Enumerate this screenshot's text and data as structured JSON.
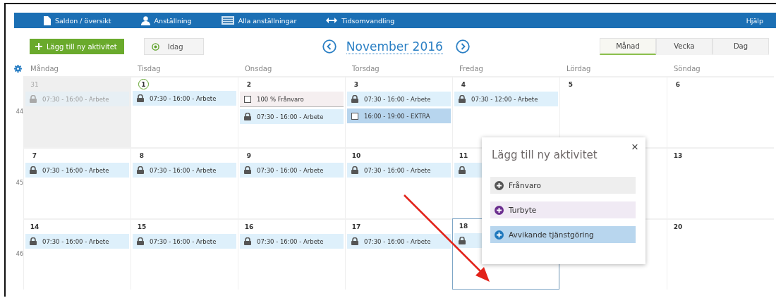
{
  "nav": {
    "items": [
      {
        "label": "Saldon / översikt"
      },
      {
        "label": "Anställning"
      },
      {
        "label": "Alla anställningar"
      },
      {
        "label": "Tidsomvandling"
      }
    ],
    "help": "Hjälp"
  },
  "toolbar": {
    "add_button": "Lägg till ny aktivitet",
    "today_button": "Idag",
    "month_title": "November 2016",
    "views": [
      {
        "label": "Månad",
        "selected": true
      },
      {
        "label": "Vecka",
        "selected": false
      },
      {
        "label": "Dag",
        "selected": false
      }
    ]
  },
  "calendar": {
    "weekdays": [
      "Måndag",
      "Tisdag",
      "Onsdag",
      "Torsdag",
      "Fredag",
      "Lördag",
      "Söndag"
    ],
    "weeks": [
      {
        "number": "44",
        "days": [
          {
            "date": "31",
            "other_month": true,
            "today": false,
            "selected": false,
            "events": [
              {
                "kind": "work",
                "text": "07:30 - 16:00 - Arbete"
              }
            ]
          },
          {
            "date": "1",
            "other_month": false,
            "today": true,
            "selected": false,
            "events": [
              {
                "kind": "work",
                "text": "07:30 - 16:00 - Arbete"
              }
            ]
          },
          {
            "date": "2",
            "other_month": false,
            "today": false,
            "selected": false,
            "events": [
              {
                "kind": "absence",
                "text": "100 % Frånvaro"
              },
              {
                "kind": "work",
                "text": "07:30 - 16:00 - Arbete"
              }
            ]
          },
          {
            "date": "3",
            "other_month": false,
            "today": false,
            "selected": false,
            "events": [
              {
                "kind": "work",
                "text": "07:30 - 16:00 - Arbete"
              },
              {
                "kind": "extra",
                "text": "16:00 - 19:00 - EXTRA"
              }
            ]
          },
          {
            "date": "4",
            "other_month": false,
            "today": false,
            "selected": false,
            "events": [
              {
                "kind": "work",
                "text": "07:30 - 12:00 - Arbete"
              }
            ]
          },
          {
            "date": "5",
            "other_month": false,
            "today": false,
            "selected": false
          },
          {
            "date": "6",
            "other_month": false,
            "today": false,
            "selected": false
          }
        ]
      },
      {
        "number": "45",
        "days": [
          {
            "date": "7",
            "other_month": false,
            "today": false,
            "selected": false,
            "events": [
              {
                "kind": "work",
                "text": "07:30 - 16:00 - Arbete"
              }
            ]
          },
          {
            "date": "8",
            "other_month": false,
            "today": false,
            "selected": false,
            "events": [
              {
                "kind": "work",
                "text": "07:30 - 16:00 - Arbete"
              }
            ]
          },
          {
            "date": "9",
            "other_month": false,
            "today": false,
            "selected": false,
            "events": [
              {
                "kind": "work",
                "text": "07:30 - 16:00 - Arbete"
              }
            ]
          },
          {
            "date": "10",
            "other_month": false,
            "today": false,
            "selected": false,
            "events": [
              {
                "kind": "work",
                "text": "07:30 - 16:00 - Arbete"
              }
            ]
          },
          {
            "date": "11",
            "other_month": false,
            "today": false,
            "selected": false,
            "events": [
              {
                "kind": "work"
              }
            ]
          },
          {
            "other_month": false,
            "today": false,
            "selected": false
          },
          {
            "date": "13",
            "other_month": false,
            "today": false,
            "selected": false
          }
        ]
      },
      {
        "number": "46",
        "days": [
          {
            "date": "14",
            "other_month": false,
            "today": false,
            "selected": false,
            "events": [
              {
                "kind": "work",
                "text": "07:30 - 16:00 - Arbete"
              }
            ]
          },
          {
            "date": "15",
            "other_month": false,
            "today": false,
            "selected": false,
            "events": [
              {
                "kind": "work",
                "text": "07:30 - 16:00 - Arbete"
              }
            ]
          },
          {
            "date": "16",
            "other_month": false,
            "today": false,
            "selected": false,
            "events": [
              {
                "kind": "work",
                "text": "07:30 - 16:00 - Arbete"
              }
            ]
          },
          {
            "date": "17",
            "other_month": false,
            "today": false,
            "selected": false,
            "events": [
              {
                "kind": "work",
                "text": "07:30 - 16:00 - Arbete"
              }
            ]
          },
          {
            "date": "18",
            "other_month": false,
            "today": false,
            "selected": true,
            "events": [
              {
                "kind": "work"
              }
            ]
          },
          {
            "other_month": false,
            "today": false,
            "selected": false
          },
          {
            "date": "20",
            "other_month": false,
            "today": false,
            "selected": false
          }
        ]
      }
    ]
  },
  "popup": {
    "title": "Lägg till ny aktivitet",
    "close": "×",
    "options": [
      {
        "label": "Frånvaro",
        "color": "#555555",
        "selected": false
      },
      {
        "label": "Turbyte",
        "color": "#6b2d8f",
        "selected": false
      },
      {
        "label": "Avvikande tjänstgöring",
        "color": "#1f78bd",
        "selected": true
      }
    ]
  }
}
